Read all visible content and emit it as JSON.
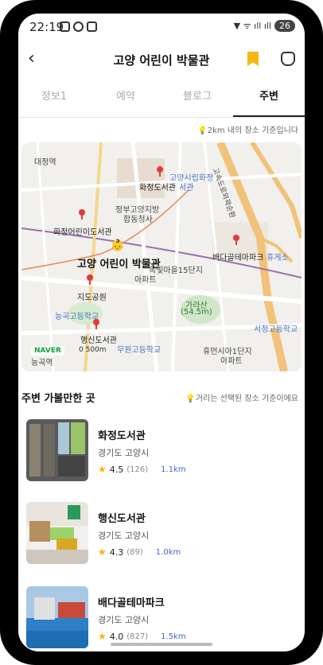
{
  "status": {
    "time": "22:19",
    "battery": "26"
  },
  "header": {
    "back": "‹",
    "title": "고양 어린이 박물관"
  },
  "tabs": [
    {
      "label": "정보1"
    },
    {
      "label": "예약"
    },
    {
      "label": "블로그"
    },
    {
      "label": "주변"
    }
  ],
  "map_note": "💡2km 내의 장소 기준입니다",
  "map": {
    "labels": {
      "daejeong": "대정역",
      "hwajeong": "화정도서관",
      "goyang_lib": "고양시립화정",
      "goyang_lib2": "서관",
      "government": "정부고양지방",
      "government2": "합동청사",
      "child_lib": "화정어린이도서관",
      "museum": "고양 어린이 박물관",
      "apartment1": "옥빛마을15단지",
      "apartment1b": "아파트",
      "jido_park": "지도공원",
      "neunggok": "능곡고등학교",
      "garasan": "가라산",
      "garasan_h": "(54.5m)",
      "seojeong": "서정고등학교",
      "haengsin": "행신도서관",
      "school2": "무원고등학교",
      "apartment2": "휴먼시아1단지",
      "apartment2b": "아파트",
      "baeda": "배다골테마파크",
      "rest": "휴게소",
      "expressway": "고속도로외곽순환",
      "neunggok_st": "능곡역",
      "naver": "NAVER",
      "scale": "0    500m"
    }
  },
  "section": {
    "title": "주변 가볼만한 곳",
    "note": "💡거리는 선택된 장소 기준이에요"
  },
  "places": [
    {
      "name": "화정도서관",
      "addr": "경기도 고양시",
      "rating": "4.5",
      "count": "(126)",
      "dist": "1.1km"
    },
    {
      "name": "행신도서관",
      "addr": "경기도 고양시",
      "rating": "4.3",
      "count": "(89)",
      "dist": "1.0km"
    },
    {
      "name": "배다골테마파크",
      "addr": "경기도 고양시",
      "rating": "4.0",
      "count": "(827)",
      "dist": "1.5km"
    }
  ],
  "icons": {
    "back": "back-arrow-icon",
    "bookmark": "bookmark-icon",
    "profile": "face-icon",
    "star": "star-icon"
  },
  "colors": {
    "accent": "#4167c7",
    "bookmark": "#f6b818",
    "naver": "#14a43d",
    "pin": "#e23a3a"
  }
}
